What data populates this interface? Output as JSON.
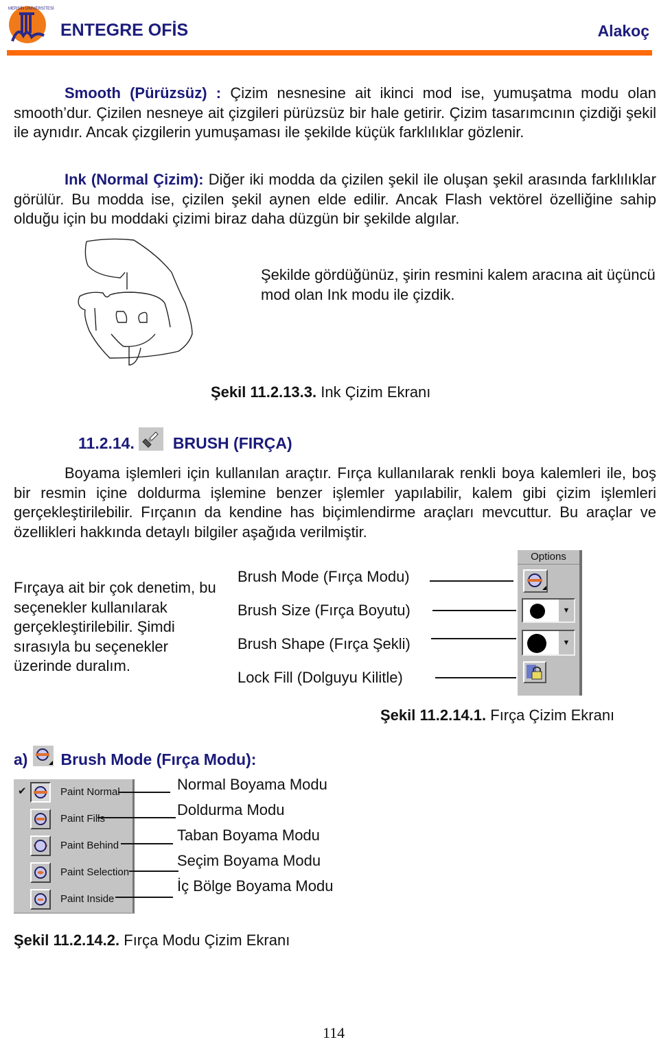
{
  "header": {
    "logo_alt": "Mersin Üniversitesi 1992",
    "brand": "ENTEGRE OFİS",
    "author": "Alakoç",
    "accent_color": "#ff6a0a",
    "title_color": "#1c1c7c"
  },
  "smooth": {
    "term": "Smooth (Pürüzsüz) :",
    "text": " Çizim nesnesine ait ikinci mod ise, yumuşatma modu olan smooth’dur. Çizilen nesneye ait çizgileri pürüzsüz bir hale getirir. Çizim tasarımcının çizdiği şekil ile aynıdır. Ancak çizgilerin yumuşaması ile şekilde küçük farklılıklar gözlenir."
  },
  "ink": {
    "term": "Ink (Normal Çizim):",
    "text": " Diğer iki modda da çizilen şekil ile oluşan şekil arasında farklılıklar görülür. Bu modda ise, çizilen şekil aynen elde edilir. Ancak Flash vektörel özelliğine sahip olduğu için bu moddaki çizimi biraz daha düzgün bir şekilde algılar."
  },
  "sketch": {
    "caption": "Şekilde gördüğünüz, şirin resmini kalem aracına ait üçüncü mod olan Ink modu ile çizdik.",
    "figure_number": "Şekil 11.2.13.3.",
    "figure_title": " Ink Çizim Ekranı"
  },
  "brush_section": {
    "number": "11.2.14.",
    "title": "BRUSH (FIRÇA)",
    "text": "Boyama işlemleri için kullanılan araçtır. Fırça kullanılarak renkli boya kalemleri ile, boş bir resmin içine doldurma işlemine benzer işlemler yapılabilir, kalem gibi çizim işlemleri gerçekleştirilebilir. Fırçanın da kendine has biçimlendirme araçları mevcuttur. Bu araçlar ve özellikleri hakkında detaylı bilgiler aşağıda verilmiştir."
  },
  "options": {
    "side_text": "Fırçaya ait bir çok denetim, bu seçenekler  kullanılarak gerçekleştirilebilir. Şimdi sırasıyla  bu seçenekler üzerinde duralım.",
    "panel_title": "Options",
    "labels": [
      "Brush Mode (Fırça Modu)",
      "Brush Size (Fırça Boyutu)",
      "Brush Shape (Fırça Şekli)",
      "Lock Fill (Dolguyu Kilitle)"
    ],
    "figure_number": "Şekil 11.2.14.1.",
    "figure_title": " Fırça Çizim Ekranı"
  },
  "brush_mode": {
    "prefix": "a)",
    "title": "Brush Mode (Fırça Modu):",
    "menu_items": [
      {
        "label": "Paint Normal",
        "checked": true,
        "description": "Normal Boyama Modu"
      },
      {
        "label": "Paint Fills",
        "checked": false,
        "description": "Doldurma Modu"
      },
      {
        "label": "Paint Behind",
        "checked": false,
        "description": "Taban Boyama Modu"
      },
      {
        "label": "Paint Selection",
        "checked": false,
        "description": "Seçim Boyama Modu"
      },
      {
        "label": "Paint Inside",
        "checked": false,
        "description": "İç Bölge Boyama Modu"
      }
    ],
    "check_glyph": "✔",
    "figure_number": "Şekil 11.2.14.2.",
    "figure_title": " Fırça Modu Çizim Ekranı"
  },
  "page_number": "114"
}
